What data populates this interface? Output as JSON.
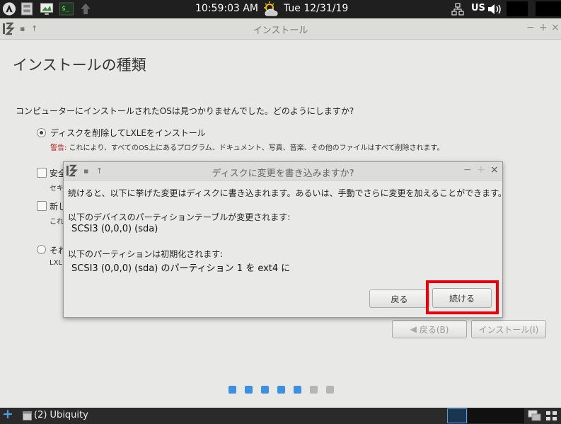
{
  "top_panel": {
    "clock": "10:59:03 AM",
    "date": "Tue 12/31/19",
    "keyboard_layout": "US"
  },
  "main_window": {
    "title": "インストール",
    "heading": "インストールの種類",
    "question": "コンピューターにインストールされたOSは見つかりませんでした。どのようにしますか?",
    "options": [
      {
        "label": "ディスクを削除してLXLEをインストール",
        "warning_prefix": "警告:",
        "sub": " これにより、すべてのOS上にあるプログラム、ドキュメント、写真、音楽、その他のファイルはすべて削除されます。",
        "checked": true
      },
      {
        "label": "安全",
        "sub": "セキ"
      },
      {
        "label": "新し",
        "sub": "これ"
      },
      {
        "label": "それ",
        "sub": "LXL"
      }
    ],
    "back_button": "戻る(B)",
    "install_button": "インストール(I)",
    "progress": {
      "total": 7,
      "done": 5,
      "active_color": "#3d8fe0",
      "inactive_color": "#b5b5b3"
    }
  },
  "dialog": {
    "title": "ディスクに変更を書き込みますか?",
    "intro": "続けると、以下に挙げた変更はディスクに書き込まれます。あるいは、手動でさらに変更を加えることができます。",
    "partition_table_label": "以下のデバイスのパーティションテーブルが変更されます:",
    "partition_table_device": "SCSI3 (0,0,0) (sda)",
    "format_label": "以下のパーティションは初期化されます:",
    "format_device": "SCSI3 (0,0,0) (sda) のパーティション 1 を ext4 に",
    "back_button": "戻る",
    "continue_button": "続ける",
    "highlight_color": "#e8000b"
  },
  "taskbar": {
    "task_label": "(2) Ubiquity"
  }
}
